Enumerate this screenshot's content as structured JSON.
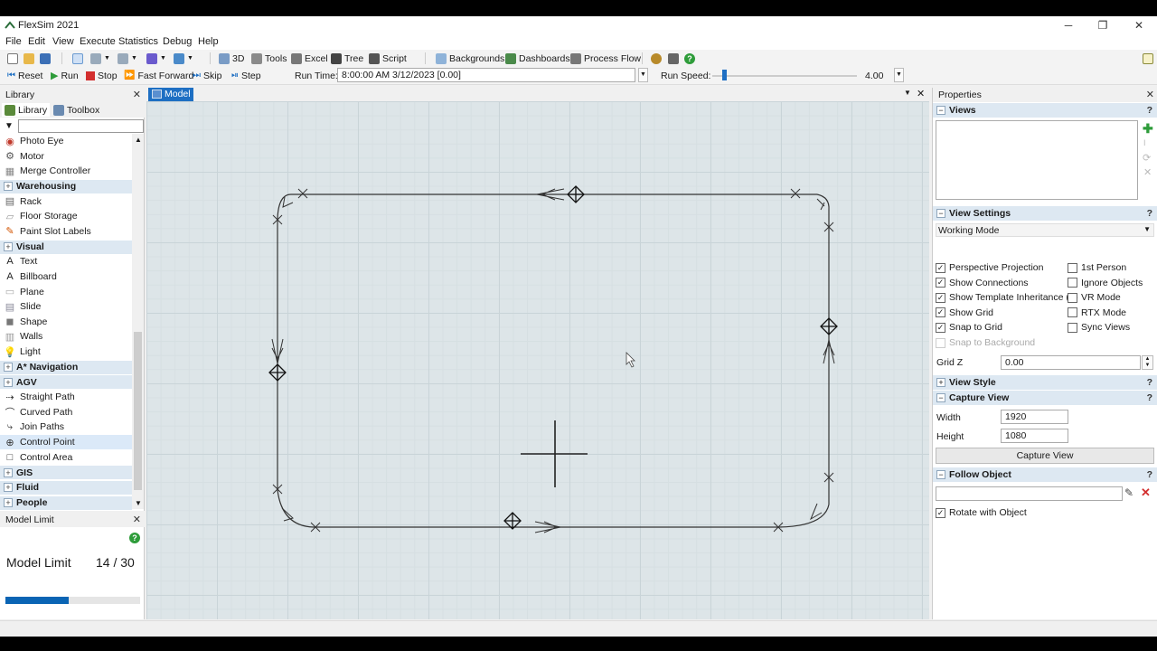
{
  "window": {
    "title": "FlexSim 2021",
    "minimize": "─",
    "maximize": "❐",
    "close": "✕"
  },
  "menu": [
    "File",
    "Edit",
    "View",
    "Execute",
    "Statistics",
    "Debug",
    "Help"
  ],
  "toolbar": {
    "btn_3d": "3D",
    "tools": "Tools",
    "excel": "Excel",
    "tree": "Tree",
    "script": "Script",
    "backgrounds": "Backgrounds",
    "dashboards": "Dashboards",
    "process_flow": "Process Flow"
  },
  "run_controls": {
    "reset": "Reset",
    "run": "Run",
    "stop": "Stop",
    "fast_forward": "Fast Forward",
    "skip": "Skip",
    "step": "Step",
    "run_time_label": "Run Time:",
    "run_time_value": "8:00:00 AM  3/12/2023  [0.00]",
    "run_speed_label": "Run Speed:",
    "run_speed_value": "4.00"
  },
  "library": {
    "panel_title": "Library",
    "tabs": [
      "Library",
      "Toolbox"
    ],
    "items": [
      {
        "label": "Photo Eye",
        "type": "item",
        "icon": "photo-eye-icon",
        "glyph": "◉",
        "color": "#c0392b"
      },
      {
        "label": "Motor",
        "type": "item",
        "icon": "motor-icon",
        "glyph": "⚙",
        "color": "#555"
      },
      {
        "label": "Merge Controller",
        "type": "item",
        "icon": "merge-controller-icon",
        "glyph": "▦",
        "color": "#888"
      },
      {
        "label": "Warehousing",
        "type": "category"
      },
      {
        "label": "Rack",
        "type": "item",
        "icon": "rack-icon",
        "glyph": "▤",
        "color": "#666"
      },
      {
        "label": "Floor Storage",
        "type": "item",
        "icon": "floor-storage-icon",
        "glyph": "▱",
        "color": "#999"
      },
      {
        "label": "Paint Slot Labels",
        "type": "item",
        "icon": "paint-icon",
        "glyph": "✎",
        "color": "#d35400"
      },
      {
        "label": "Visual",
        "type": "category"
      },
      {
        "label": "Text",
        "type": "item",
        "icon": "text-icon",
        "glyph": "A",
        "color": "#222"
      },
      {
        "label": "Billboard",
        "type": "item",
        "icon": "billboard-icon",
        "glyph": "A",
        "color": "#222"
      },
      {
        "label": "Plane",
        "type": "item",
        "icon": "plane-icon",
        "glyph": "▭",
        "color": "#aaa"
      },
      {
        "label": "Slide",
        "type": "item",
        "icon": "slide-icon",
        "glyph": "▤",
        "color": "#889"
      },
      {
        "label": "Shape",
        "type": "item",
        "icon": "shape-icon",
        "glyph": "◼",
        "color": "#777"
      },
      {
        "label": "Walls",
        "type": "item",
        "icon": "walls-icon",
        "glyph": "▥",
        "color": "#999"
      },
      {
        "label": "Light",
        "type": "item",
        "icon": "light-bulb-icon",
        "glyph": "💡",
        "color": "#e6b800"
      },
      {
        "label": "A* Navigation",
        "type": "category"
      },
      {
        "label": "AGV",
        "type": "category"
      },
      {
        "label": "Straight Path",
        "type": "item",
        "icon": "straight-path-icon",
        "glyph": "⇢",
        "color": "#333"
      },
      {
        "label": "Curved Path",
        "type": "item",
        "icon": "curved-path-icon",
        "glyph": "⌒",
        "color": "#333"
      },
      {
        "label": "Join Paths",
        "type": "item",
        "icon": "join-paths-icon",
        "glyph": "⤷",
        "color": "#333"
      },
      {
        "label": "Control Point",
        "type": "item",
        "icon": "control-point-icon",
        "glyph": "⊕",
        "color": "#333",
        "selected": true
      },
      {
        "label": "Control Area",
        "type": "item",
        "icon": "control-area-icon",
        "glyph": "□",
        "color": "#333"
      },
      {
        "label": "GIS",
        "type": "category"
      },
      {
        "label": "Fluid",
        "type": "category"
      },
      {
        "label": "People",
        "type": "category"
      }
    ]
  },
  "model_limit": {
    "panel_title": "Model Limit",
    "label": "Model Limit",
    "value": "14 / 30",
    "used": 14,
    "max": 30
  },
  "model": {
    "tab": "Model"
  },
  "properties": {
    "panel_title": "Properties",
    "views_title": "Views",
    "view_settings_title": "View Settings",
    "working_mode": "Working Mode",
    "checkboxes_left": [
      {
        "label": "Perspective Projection",
        "checked": true
      },
      {
        "label": "Show Connections",
        "checked": true
      },
      {
        "label": "Show Template Inheritance (T)",
        "checked": true
      },
      {
        "label": "Show Grid",
        "checked": true
      },
      {
        "label": "Snap to Grid",
        "checked": true
      },
      {
        "label": "Snap to Background",
        "checked": false,
        "disabled": true
      }
    ],
    "checkboxes_right": [
      {
        "label": "1st Person",
        "checked": false
      },
      {
        "label": "Ignore Objects",
        "checked": false
      },
      {
        "label": "VR Mode",
        "checked": false
      },
      {
        "label": "RTX Mode",
        "checked": false
      },
      {
        "label": "Sync Views",
        "checked": false
      }
    ],
    "grid_z_label": "Grid Z",
    "grid_z_value": "0.00",
    "view_style_title": "View Style",
    "capture_view_title": "Capture View",
    "width_label": "Width",
    "width_value": "1920",
    "height_label": "Height",
    "height_value": "1080",
    "capture_button": "Capture View",
    "follow_object_title": "Follow Object",
    "rotate_label": "Rotate with Object",
    "rotate_checked": true
  }
}
